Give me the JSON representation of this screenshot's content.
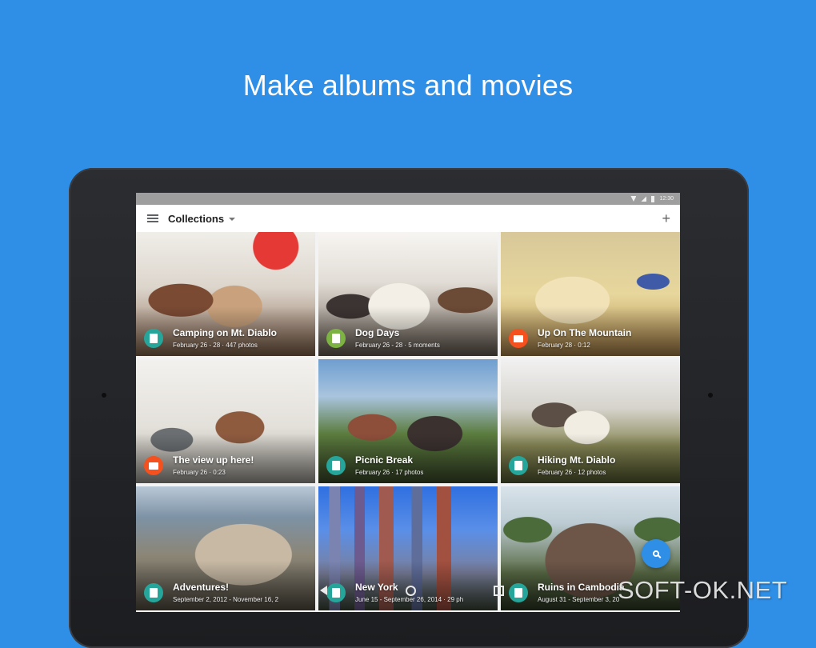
{
  "headline": "Make albums and movies",
  "status_bar": {
    "time": "12:30"
  },
  "app_bar": {
    "title": "Collections"
  },
  "cards": [
    {
      "title": "Camping on Mt. Diablo",
      "subtitle": "February 26 - 28 · 447 photos",
      "type": "album",
      "badge_color": "#26a69a"
    },
    {
      "title": "Dog Days",
      "subtitle": "February 26 - 28 · 5 moments",
      "type": "story",
      "badge_color": "#7cb342"
    },
    {
      "title": "Up On The Mountain",
      "subtitle": "February 28 · 0:12",
      "type": "movie",
      "badge_color": "#f4511e"
    },
    {
      "title": "The view up here!",
      "subtitle": "February 26 · 0:23",
      "type": "movie",
      "badge_color": "#f4511e"
    },
    {
      "title": "Picnic Break",
      "subtitle": "February 26 · 17 photos",
      "type": "album",
      "badge_color": "#26a69a"
    },
    {
      "title": "Hiking Mt. Diablo",
      "subtitle": "February 26 · 12 photos",
      "type": "album",
      "badge_color": "#26a69a"
    },
    {
      "title": "Adventures!",
      "subtitle": "September 2, 2012 - November 16, 2",
      "type": "album",
      "badge_color": "#26a69a"
    },
    {
      "title": "New York",
      "subtitle": "June 15 - September 26, 2014 · 29 ph",
      "type": "album",
      "badge_color": "#26a69a"
    },
    {
      "title": "Ruins in Cambodia",
      "subtitle": "August 31 - September 3, 20",
      "type": "album",
      "badge_color": "#26a69a"
    }
  ],
  "watermark": "SOFT-OK.NET",
  "colors": {
    "background": "#2f8fe6",
    "accent": "#2f8fe6",
    "album": "#26a69a",
    "story": "#7cb342",
    "movie": "#f4511e"
  }
}
